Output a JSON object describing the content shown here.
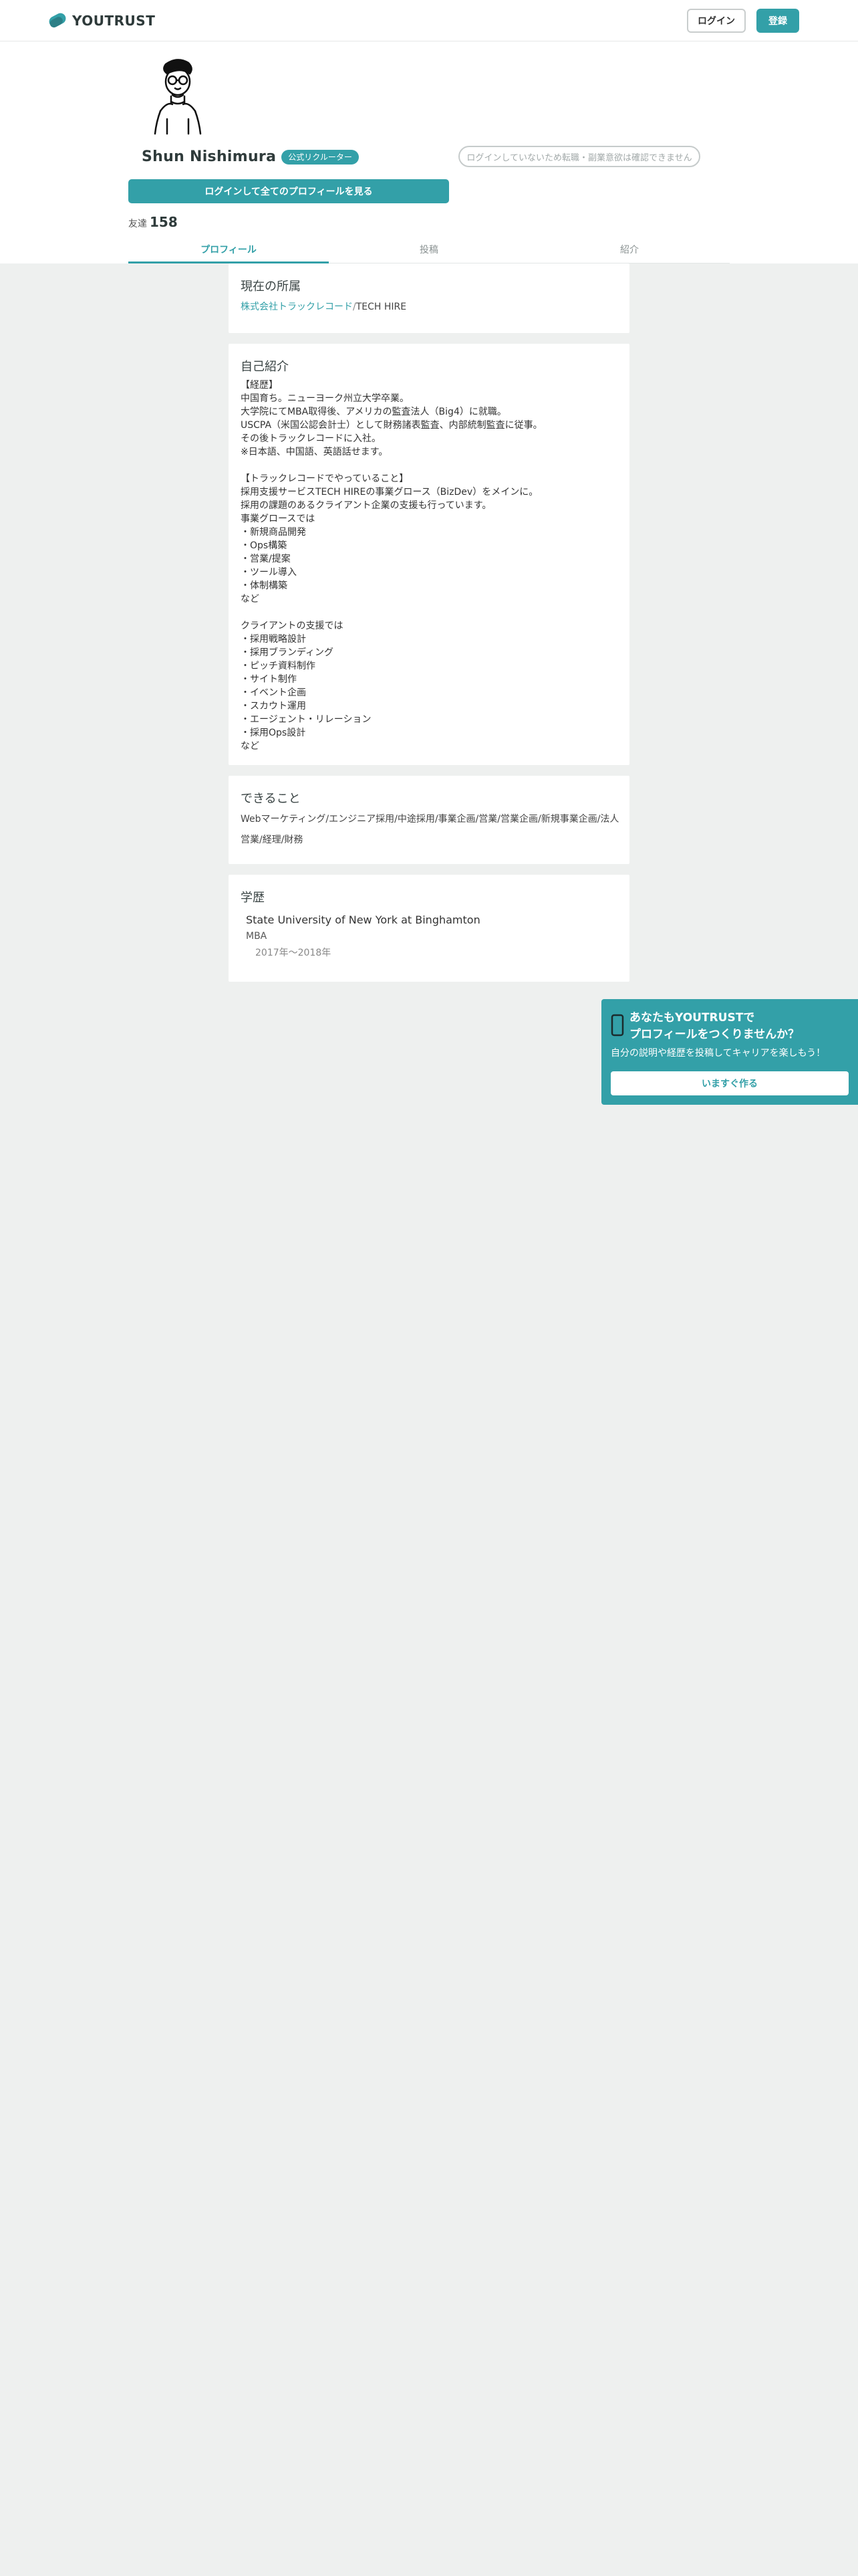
{
  "header": {
    "logo_text": "YOUTRUST",
    "login_label": "ログイン",
    "register_label": "登録"
  },
  "profile": {
    "name": "Shun Nishimura",
    "badge": "公式リクルーター",
    "disabled_notice": "ログインしていないため転職・副業意欲は確認できません",
    "view_full_label": "ログインして全てのプロフィールを見る",
    "friends_label": "友達",
    "friends_count": "158"
  },
  "tabs": [
    {
      "label": "プロフィール",
      "active": true
    },
    {
      "label": "投稿",
      "active": false
    },
    {
      "label": "紹介",
      "active": false
    }
  ],
  "affiliation": {
    "title": "現在の所属",
    "company": "株式会社トラックレコード",
    "separator": "/",
    "department": "TECH HIRE"
  },
  "intro": {
    "title": "自己紹介",
    "text": "【経歴】\n中国育ち。ニューヨーク州立大学卒業。\n大学院にてMBA取得後、アメリカの監査法人（Big4）に就職。\nUSCPA（米国公認会計士）として財務諸表監査、内部統制監査に従事。\nその後トラックレコードに入社。\n※日本語、中国語、英語話せます。\n\n【トラックレコードでやっていること】\n採用支援サービスTECH HIREの事業グロース（BizDev）をメインに。\n採用の課題のあるクライアント企業の支援も行っています。\n事業グロースでは\n・新規商品開発\n・Ops構築\n・営業/提案\n・ツール導入\n・体制構築\nなど\n\nクライアントの支援では\n・採用戦略設計\n・採用ブランディング\n・ピッチ資料制作\n・サイト制作\n・イベント企画\n・スカウト運用\n・エージェント・リレーション\n・採用Ops設計\nなど"
  },
  "skills": {
    "title": "できること",
    "text": "Webマーケティング/エンジニア採用/中途採用/事業企画/営業/営業企画/新規事業企画/法人営業/経理/財務"
  },
  "education": {
    "title": "学歴",
    "school": "State University of New York at Binghamton",
    "degree": "MBA",
    "period": "2017年〜2018年"
  },
  "cta": {
    "title": "あなたもYOUTRUSTで\nプロフィールをつくりませんか？",
    "subtitle": "自分の説明や経歴を投稿してキャリアを楽しもう！",
    "button_label": "いますぐ作る",
    "accent_color": "#33a0a8"
  }
}
